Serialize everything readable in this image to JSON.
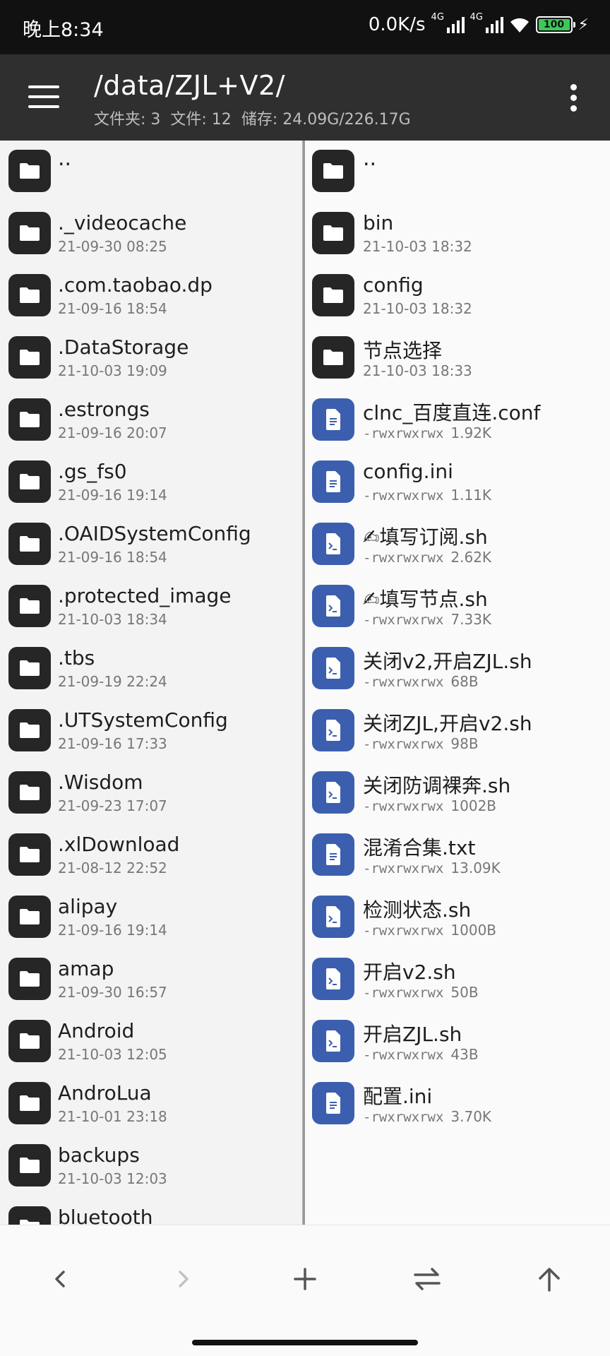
{
  "status_bar": {
    "time": "晚上8:34",
    "net_speed": "0.0K/s",
    "sim1_label": "4G",
    "sim2_label": "4G",
    "battery": "100",
    "charging_icon": "bolt-icon"
  },
  "toolbar": {
    "menu_icon": "hamburger-icon",
    "path": "/data/ZJL+V2/",
    "folders": "文件夹: 3",
    "files": "文件: 12",
    "storage": "储存: 24.09G/226.17G",
    "more_icon": "more-vert-icon"
  },
  "left_pane": {
    "items": [
      {
        "name": "..",
        "meta": ""
      },
      {
        "name": "._videocache",
        "meta": "21-09-30 08:25"
      },
      {
        "name": ".com.taobao.dp",
        "meta": "21-09-16 18:54"
      },
      {
        "name": ".DataStorage",
        "meta": "21-10-03 19:09"
      },
      {
        "name": ".estrongs",
        "meta": "21-09-16 20:07"
      },
      {
        "name": ".gs_fs0",
        "meta": "21-09-16 19:14"
      },
      {
        "name": ".OAIDSystemConfig",
        "meta": "21-09-16 18:54"
      },
      {
        "name": ".protected_image",
        "meta": "21-10-03 18:34"
      },
      {
        "name": ".tbs",
        "meta": "21-09-19 22:24"
      },
      {
        "name": ".UTSystemConfig",
        "meta": "21-09-16 17:33"
      },
      {
        "name": ".Wisdom",
        "meta": "21-09-23 17:07"
      },
      {
        "name": ".xlDownload",
        "meta": "21-08-12 22:52"
      },
      {
        "name": "alipay",
        "meta": "21-09-16 19:14"
      },
      {
        "name": "amap",
        "meta": "21-09-30 16:57"
      },
      {
        "name": "Android",
        "meta": "21-10-03 12:05"
      },
      {
        "name": "AndroLua",
        "meta": "21-10-01 23:18"
      },
      {
        "name": "backups",
        "meta": "21-10-03 12:03"
      },
      {
        "name": "bluetooth",
        "meta": ""
      }
    ]
  },
  "right_pane": {
    "items": [
      {
        "name": "..",
        "type": "folder",
        "perm": "",
        "meta": ""
      },
      {
        "name": "bin",
        "type": "folder",
        "perm": "",
        "meta": "21-10-03 18:32"
      },
      {
        "name": "config",
        "type": "folder",
        "perm": "",
        "meta": "21-10-03 18:32"
      },
      {
        "name": "节点选择",
        "type": "folder",
        "perm": "",
        "meta": "21-10-03 18:33"
      },
      {
        "name": "clnc_百度直连.conf",
        "type": "doc",
        "perm": "-rwxrwxrwx",
        "meta": "1.92K"
      },
      {
        "name": "config.ini",
        "type": "doc",
        "perm": "-rwxrwxrwx",
        "meta": "1.11K"
      },
      {
        "name": "✍填写订阅.sh",
        "type": "script",
        "perm": "-rwxrwxrwx",
        "meta": "2.62K"
      },
      {
        "name": "✍填写节点.sh",
        "type": "script",
        "perm": "-rwxrwxrwx",
        "meta": "7.33K"
      },
      {
        "name": "关闭v2,开启ZJL.sh",
        "type": "script",
        "perm": "-rwxrwxrwx",
        "meta": "68B"
      },
      {
        "name": "关闭ZJL,开启v2.sh",
        "type": "script",
        "perm": "-rwxrwxrwx",
        "meta": "98B"
      },
      {
        "name": "关闭防调裸奔.sh",
        "type": "script",
        "perm": "-rwxrwxrwx",
        "meta": "1002B"
      },
      {
        "name": "混淆合集.txt",
        "type": "doc",
        "perm": "-rwxrwxrwx",
        "meta": "13.09K"
      },
      {
        "name": "检测状态.sh",
        "type": "script",
        "perm": "-rwxrwxrwx",
        "meta": "1000B"
      },
      {
        "name": "开启v2.sh",
        "type": "script",
        "perm": "-rwxrwxrwx",
        "meta": "50B"
      },
      {
        "name": "开启ZJL.sh",
        "type": "script",
        "perm": "-rwxrwxrwx",
        "meta": "43B"
      },
      {
        "name": "配置.ini",
        "type": "doc",
        "perm": "-rwxrwxrwx",
        "meta": "3.70K"
      }
    ]
  },
  "bottom_nav": {
    "back_icon": "chevron-left-icon",
    "forward_icon": "chevron-right-icon",
    "add_icon": "plus-icon",
    "swap_icon": "swap-icon",
    "up_icon": "arrow-up-icon"
  },
  "colors": {
    "toolbar_bg": "#2f2f2f",
    "folder_icon_bg": "#262626",
    "file_icon_bg": "#3b5fae",
    "battery_fill": "#3cc85a"
  }
}
